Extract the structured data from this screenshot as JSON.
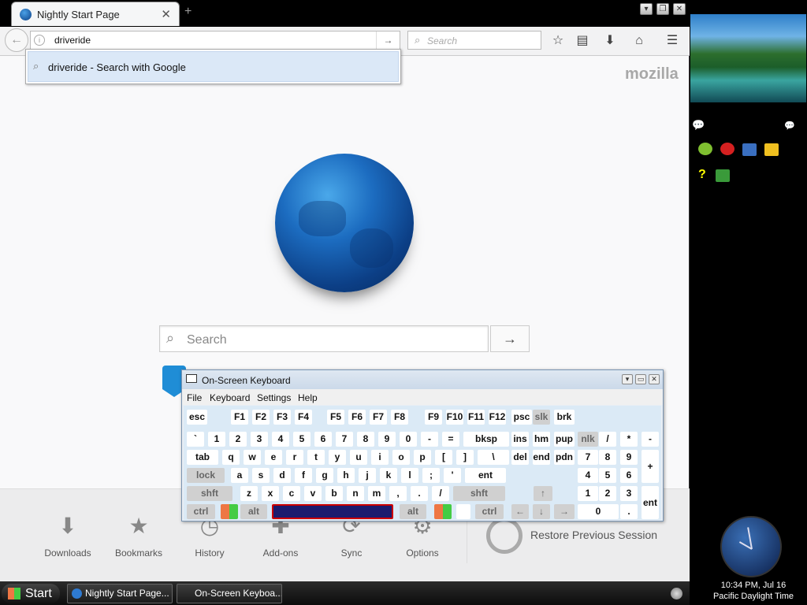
{
  "browser": {
    "tab": {
      "title": "Nightly Start Page",
      "close": "✕"
    },
    "new_tab": "+",
    "window_buttons": [
      "▾",
      "❐",
      "✕"
    ],
    "back": "←",
    "url_value": "driveride",
    "url_go": "→",
    "search_placeholder": "Search",
    "toolbar_icons": [
      "star-icon",
      "reading-list-icon",
      "download-icon",
      "home-icon",
      "menu-icon"
    ],
    "autocomplete": {
      "text": "driveride - Search with Google"
    },
    "brand": "mozilla",
    "main_search_placeholder": "Search",
    "main_search_go": "→",
    "launcher": [
      {
        "label": "Downloads",
        "icon": "⬇"
      },
      {
        "label": "Bookmarks",
        "icon": "★"
      },
      {
        "label": "History",
        "icon": "◷"
      },
      {
        "label": "Add-ons",
        "icon": "✚"
      },
      {
        "label": "Sync",
        "icon": "⟳"
      },
      {
        "label": "Options",
        "icon": "⚙"
      }
    ],
    "restore_session": "Restore Previous Session"
  },
  "osk": {
    "title": "On-Screen Keyboard",
    "menu": [
      "File",
      "Keyboard",
      "Settings",
      "Help"
    ],
    "rows": {
      "r1": [
        "esc",
        "F1",
        "F2",
        "F3",
        "F4",
        "F5",
        "F6",
        "F7",
        "F8",
        "F9",
        "F10",
        "F11",
        "F12",
        "psc",
        "slk",
        "brk"
      ],
      "r2": [
        "`",
        "1",
        "2",
        "3",
        "4",
        "5",
        "6",
        "7",
        "8",
        "9",
        "0",
        "-",
        "=",
        "bksp",
        "ins",
        "hm",
        "pup",
        "nlk",
        "/",
        "*",
        "-"
      ],
      "r3": [
        "tab",
        "q",
        "w",
        "e",
        "r",
        "t",
        "y",
        "u",
        "i",
        "o",
        "p",
        "[",
        "]",
        "\\",
        "del",
        "end",
        "pdn",
        "7",
        "8",
        "9",
        "+"
      ],
      "r4": [
        "lock",
        "a",
        "s",
        "d",
        "f",
        "g",
        "h",
        "j",
        "k",
        "l",
        ";",
        "'",
        "ent",
        "4",
        "5",
        "6"
      ],
      "r5": [
        "shft",
        "z",
        "x",
        "c",
        "v",
        "b",
        "n",
        "m",
        ",",
        ".",
        "/",
        "shft",
        "↑",
        "1",
        "2",
        "3",
        "ent"
      ],
      "r6": [
        "ctrl",
        "alt",
        "alt",
        "ctrl",
        "←",
        "↓",
        "→",
        "0",
        "."
      ]
    }
  },
  "sidebar": {
    "clock_time": "10:34 PM, Jul 16",
    "clock_tz": "Pacific Daylight Time"
  },
  "taskbar": {
    "start": "Start",
    "tasks": [
      "Nightly Start Page...",
      "On-Screen Keyboa..."
    ]
  }
}
